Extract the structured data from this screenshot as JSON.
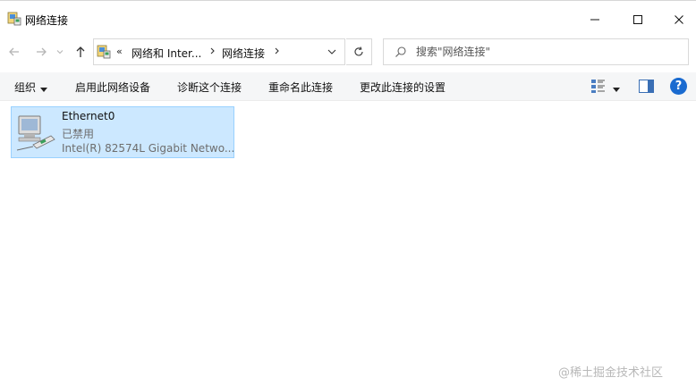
{
  "window": {
    "title": "网络连接",
    "minimize_glyph": "—",
    "maximize_glyph": "☐",
    "close_glyph": "✕"
  },
  "address": {
    "prefix": "«",
    "crumbs": [
      "网络和 Inter...",
      "网络连接"
    ],
    "search_placeholder": "搜索\"网络连接\""
  },
  "commands": {
    "organize": "组织",
    "items": [
      "启用此网络设备",
      "诊断这个连接",
      "重命名此连接",
      "更改此连接的设置"
    ]
  },
  "items": [
    {
      "name": "Ethernet0",
      "status": "已禁用",
      "description": "Intel(R) 82574L Gigabit Netwo..."
    }
  ],
  "watermark": "@稀土掘金技术社区",
  "colors": {
    "selection_bg": "#cce8ff",
    "selection_border": "#99d1ff",
    "help_blue": "#1a6bd0"
  }
}
